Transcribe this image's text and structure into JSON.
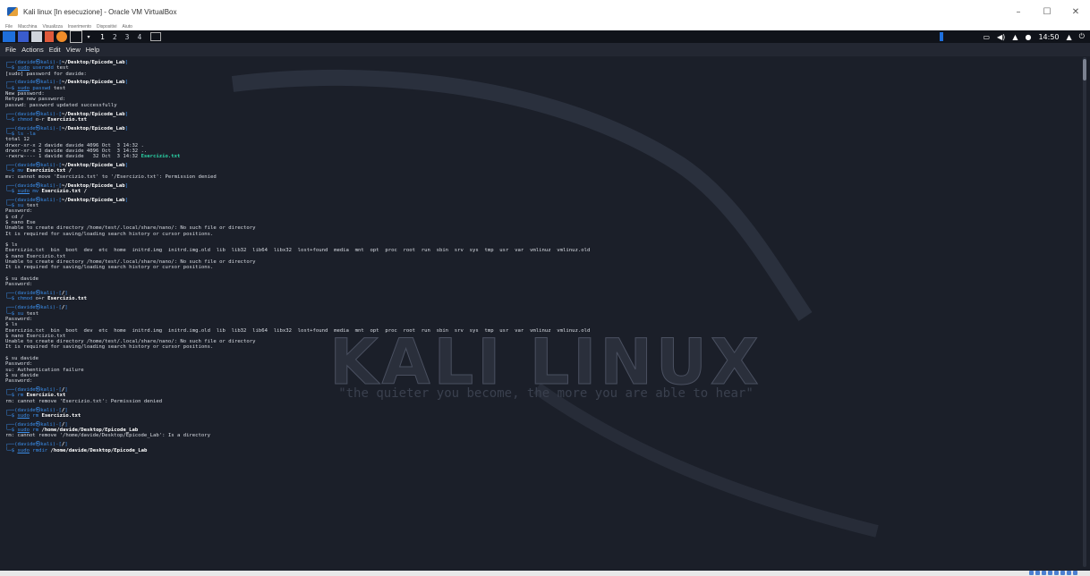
{
  "host_window": {
    "title": "Kali linux [In esecuzione] - Oracle VM VirtualBox",
    "menu": [
      "File",
      "Macchina",
      "Visualizza",
      "Inserimento",
      "Dispositivi",
      "Aiuto"
    ],
    "controls": [
      "–",
      "☐",
      "✕"
    ]
  },
  "panel": {
    "workspaces": [
      "1",
      "2",
      "3",
      "4"
    ],
    "clock": "14:50"
  },
  "app_menu": [
    "File",
    "Actions",
    "Edit",
    "View",
    "Help"
  ],
  "watermark": {
    "logo": "KALI LINUX",
    "tagline": "\"the quieter you become, the more you are able to hear\""
  },
  "terminal": {
    "user": "davide",
    "host": "kali",
    "blocks": [
      {
        "path": "~/Desktop/Epicode_Lab",
        "cmd": [
          [
            "udl",
            "sudo"
          ],
          [
            "cmd",
            " useradd"
          ],
          [
            "plain",
            " test"
          ]
        ],
        "out": [
          "[sudo] password for davide:"
        ]
      },
      {
        "path": "~/Desktop/Epicode_Lab",
        "cmd": [
          [
            "udl",
            "sudo"
          ],
          [
            "cmd",
            " passwd"
          ],
          [
            "plain",
            " test"
          ]
        ],
        "out": [
          "New password:",
          "Retype new password:",
          "passwd: password updated successfully"
        ]
      },
      {
        "path": "~/Desktop/Epicode_Lab",
        "cmd": [
          [
            "cmd",
            "chmod"
          ],
          [
            "plain",
            " o-r "
          ],
          [
            "bold",
            "Esercizio.txt"
          ]
        ],
        "out": []
      },
      {
        "path": "~/Desktop/Epicode_Lab",
        "cmd": [
          [
            "cmd",
            "ls"
          ],
          [
            "cmd",
            " -la"
          ]
        ],
        "out": [
          "total 12",
          "drwxr-xr-x 2 davide davide 4096 Oct  3 14:32 .",
          "drwxr-xr-x 3 davide davide 4096 Oct  3 14:32 ..",
          "-rwxrw---- 1 davide davide   32 Oct  3 14:32 "
        ],
        "out_tail": "Esercizio.txt"
      },
      {
        "path": "~/Desktop/Epicode_Lab",
        "cmd": [
          [
            "cmd",
            "mv"
          ],
          [
            "bold",
            " Esercizio.txt /"
          ]
        ],
        "out": [
          "mv: cannot move 'Esercizio.txt' to '/Esercizio.txt': Permission denied"
        ]
      },
      {
        "path": "~/Desktop/Epicode_Lab",
        "cmd": [
          [
            "udl",
            "sudo"
          ],
          [
            "cmd",
            " mv"
          ],
          [
            "bold",
            " Esercizio.txt /"
          ]
        ],
        "out": []
      },
      {
        "path": "~/Desktop/Epicode_Lab",
        "cmd": [
          [
            "cmd",
            "su"
          ],
          [
            "plain",
            " test"
          ]
        ],
        "out": [
          "Password:",
          "$ cd /",
          "$ nano Ese",
          "Unable to create directory /home/test/.local/share/nano/: No such file or directory",
          "It is required for saving/loading search history or cursor positions.",
          "",
          "$ ls",
          "Esercizio.txt  bin  boot  dev  etc  home  initrd.img  initrd.img.old  lib  lib32  lib64  libx32  lost+found  media  mnt  opt  proc  root  run  sbin  srv  sys  tmp  usr  var  vmlinuz  vmlinuz.old",
          "$ nano Esercizio.txt",
          "Unable to create directory /home/test/.local/share/nano/: No such file or directory",
          "It is required for saving/loading search history or cursor positions.",
          "",
          "$ su davide",
          "Password:"
        ]
      },
      {
        "path": "/",
        "cmd": [
          [
            "cmd",
            "chmod"
          ],
          [
            "plain",
            " o+r "
          ],
          [
            "bold",
            "Esercizio.txt"
          ]
        ],
        "out": []
      },
      {
        "path": "/",
        "cmd": [
          [
            "cmd",
            "su"
          ],
          [
            "plain",
            " test"
          ]
        ],
        "out": [
          "Password:",
          "$ ls",
          "Esercizio.txt  bin  boot  dev  etc  home  initrd.img  initrd.img.old  lib  lib32  lib64  libx32  lost+found  media  mnt  opt  proc  root  run  sbin  srv  sys  tmp  usr  var  vmlinuz  vmlinuz.old",
          "$ nano Esercizio.txt",
          "Unable to create directory /home/test/.local/share/nano/: No such file or directory",
          "It is required for saving/loading search history or cursor positions.",
          "",
          "$ su davide",
          "Password:",
          "su: Authentication failure",
          "$ su davide",
          "Password:"
        ]
      },
      {
        "path": "/",
        "cmd": [
          [
            "cmd",
            "rm"
          ],
          [
            "bold",
            " Esercizio.txt"
          ]
        ],
        "out": [
          "rm: cannot remove 'Esercizio.txt': Permission denied"
        ]
      },
      {
        "path": "/",
        "cmd": [
          [
            "udl",
            "sudo"
          ],
          [
            "cmd",
            " rm"
          ],
          [
            "bold",
            " Esercizio.txt"
          ]
        ],
        "out": []
      },
      {
        "path": "/",
        "cmd": [
          [
            "udl",
            "sudo"
          ],
          [
            "cmd",
            " rm"
          ],
          [
            "bold",
            " /home/davide/Desktop/Epicode_Lab"
          ]
        ],
        "out": [
          "rm: cannot remove '/home/davide/Desktop/Epicode_Lab': Is a directory"
        ]
      },
      {
        "path": "/",
        "cmd": [
          [
            "udl",
            "sudo"
          ],
          [
            "cmd",
            " rmdir"
          ],
          [
            "bold",
            " /home/davide/Desktop/Epicode_Lab"
          ]
        ],
        "out": []
      }
    ]
  }
}
